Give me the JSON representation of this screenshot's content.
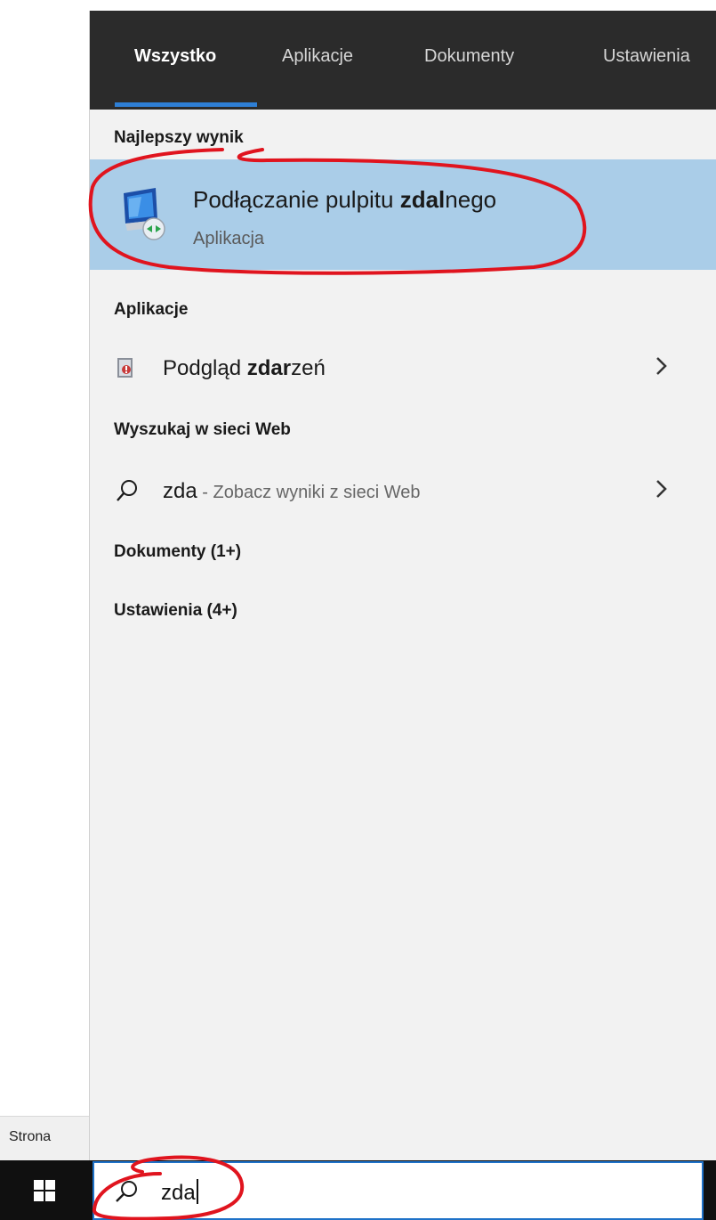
{
  "tabs": [
    {
      "label": "Wszystko",
      "active": true
    },
    {
      "label": "Aplikacje",
      "active": false
    },
    {
      "label": "Dokumenty",
      "active": false
    },
    {
      "label": "Ustawienia",
      "active": false
    }
  ],
  "best_match": {
    "header": "Najlepszy wynik",
    "title_pre": "Podłączanie pulpitu ",
    "title_bold": "zdal",
    "title_post": "nego",
    "subtitle": "Aplikacja",
    "icon": "remote-desktop-icon"
  },
  "apps": {
    "header": "Aplikacje",
    "items": [
      {
        "label_pre": "Podgląd ",
        "label_bold": "zdar",
        "label_post": "zeń",
        "icon": "event-viewer-icon"
      }
    ]
  },
  "web": {
    "header": "Wyszukaj w sieci Web",
    "query": "zda",
    "suffix": " - Zobacz wyniki z sieci Web",
    "icon": "search-icon"
  },
  "documents_header": "Dokumenty (1+)",
  "settings_header": "Ustawienia (4+)",
  "background_window_label": "Strona",
  "taskbar": {
    "search_value": "zda",
    "start_icon": "windows-logo-icon"
  },
  "colors": {
    "accent": "#2e7fd6",
    "selection": "#aacde8",
    "tabbar": "#2b2b2b",
    "annotation": "#e0141e"
  }
}
